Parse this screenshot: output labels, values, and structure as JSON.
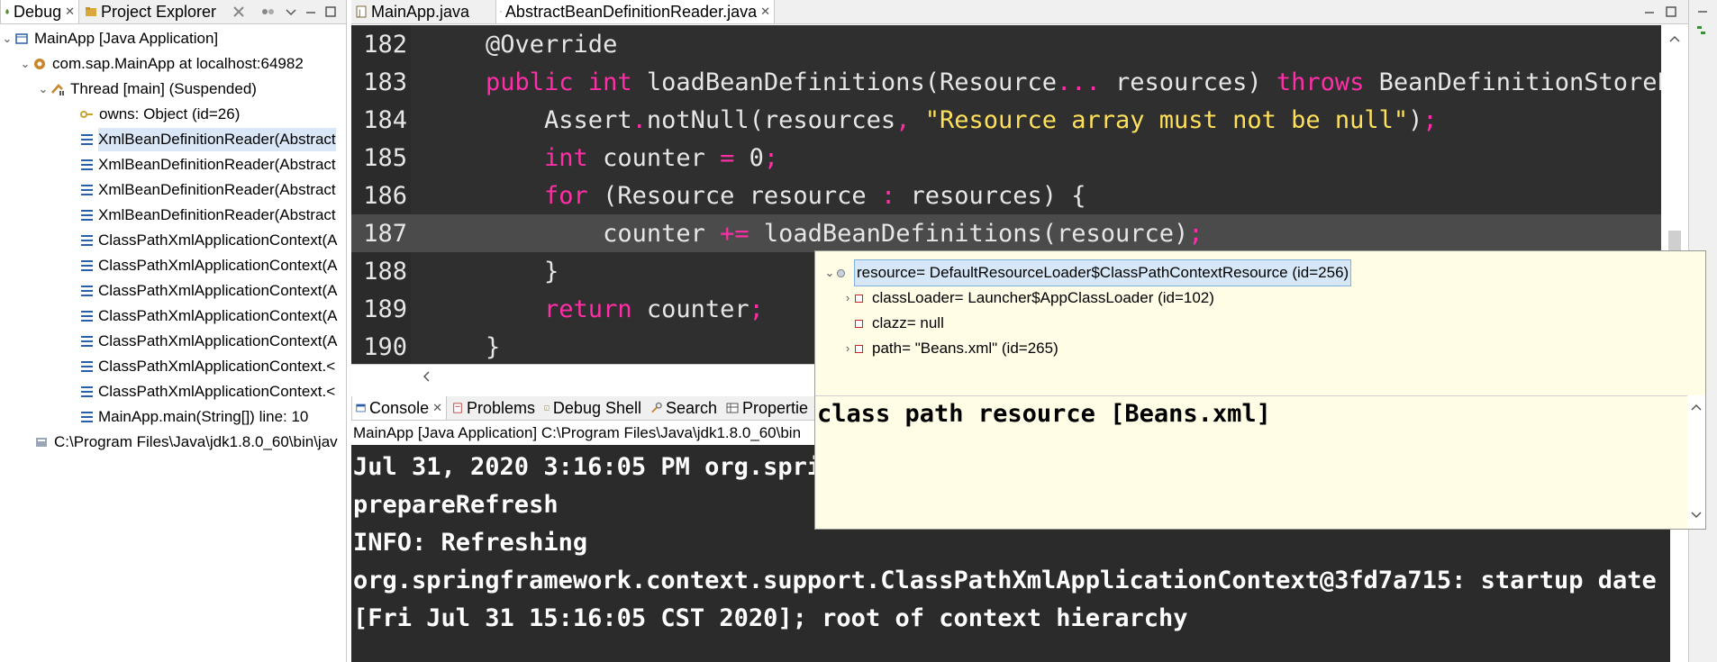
{
  "left_panel": {
    "tabs": [
      {
        "label": "Debug",
        "close": "✕"
      },
      {
        "label": "Project Explorer",
        "close": "✕"
      }
    ],
    "tree": [
      {
        "label": "MainApp [Java Application]"
      },
      {
        "label": "com.sap.MainApp at localhost:64982"
      },
      {
        "label": "Thread [main] (Suspended)"
      },
      {
        "label": "owns: Object  (id=26)"
      },
      {
        "label": "XmlBeanDefinitionReader(Abstract"
      },
      {
        "label": "XmlBeanDefinitionReader(Abstract"
      },
      {
        "label": "XmlBeanDefinitionReader(Abstract"
      },
      {
        "label": "XmlBeanDefinitionReader(Abstract"
      },
      {
        "label": "ClassPathXmlApplicationContext(A"
      },
      {
        "label": "ClassPathXmlApplicationContext(A"
      },
      {
        "label": "ClassPathXmlApplicationContext(A"
      },
      {
        "label": "ClassPathXmlApplicationContext(A"
      },
      {
        "label": "ClassPathXmlApplicationContext(A"
      },
      {
        "label": "ClassPathXmlApplicationContext.<"
      },
      {
        "label": "ClassPathXmlApplicationContext.<"
      },
      {
        "label": "MainApp.main(String[]) line: 10"
      },
      {
        "label": "C:\\Program Files\\Java\\jdk1.8.0_60\\bin\\jav"
      }
    ]
  },
  "editor": {
    "tabs": [
      {
        "label": "MainApp.java"
      },
      {
        "label": "AbstractBeanDefinitionReader.java",
        "close": "✕"
      }
    ],
    "lines": [
      {
        "num": "182",
        "parts": [
          [
            "ident",
            "    @Override"
          ]
        ]
      },
      {
        "num": "183",
        "parts": [
          [
            "kw",
            "    public int "
          ],
          [
            "ident",
            "loadBeanDefinitions(Resource"
          ],
          [
            "op",
            "..."
          ],
          [
            "ident",
            " resources) "
          ],
          [
            "kw",
            "throws "
          ],
          [
            "ident",
            "BeanDefinitionStoreEx"
          ]
        ]
      },
      {
        "num": "184",
        "parts": [
          [
            "ident",
            "        Assert"
          ],
          [
            "op",
            "."
          ],
          [
            "ident",
            "notNull(resources"
          ],
          [
            "op",
            ", "
          ],
          [
            "str",
            "\"Resource array must not be null\""
          ],
          [
            "ident",
            ")"
          ],
          [
            "op",
            ";"
          ]
        ]
      },
      {
        "num": "185",
        "parts": [
          [
            "kw",
            "        int "
          ],
          [
            "ident",
            "counter "
          ],
          [
            "op",
            "= "
          ],
          [
            "ident",
            "0"
          ],
          [
            "op",
            ";"
          ]
        ]
      },
      {
        "num": "186",
        "parts": [
          [
            "kw",
            "        for "
          ],
          [
            "ident",
            "(Resource resource "
          ],
          [
            "op",
            ": "
          ],
          [
            "ident",
            "resources) {"
          ]
        ]
      },
      {
        "num": "187",
        "parts": [
          [
            "ident",
            "            counter "
          ],
          [
            "op",
            "+= "
          ],
          [
            "ident",
            "loadBeanDefinitions(resource)"
          ],
          [
            "op",
            ";"
          ]
        ]
      },
      {
        "num": "188",
        "parts": [
          [
            "ident",
            "        }"
          ]
        ]
      },
      {
        "num": "189",
        "parts": [
          [
            "kw",
            "        return "
          ],
          [
            "ident",
            "counter"
          ],
          [
            "op",
            ";"
          ]
        ]
      },
      {
        "num": "190",
        "parts": [
          [
            "ident",
            "    }"
          ]
        ]
      }
    ]
  },
  "console": {
    "tabs": [
      {
        "label": "Console",
        "close": "✕"
      },
      {
        "label": "Problems"
      },
      {
        "label": "Debug Shell"
      },
      {
        "label": "Search"
      },
      {
        "label": "Propertie"
      }
    ],
    "subtitle": "MainApp [Java Application] C:\\Program Files\\Java\\jdk1.8.0_60\\bin",
    "lines": [
      "Jul 31, 2020 3:16:05 PM org.spri",
      "prepareRefresh",
      "INFO: Refreshing",
      "org.springframework.context.support.ClassPathXmlApplicationContext@3fd7a715: startup date",
      "[Fri Jul 31 15:16:05 CST 2020]; root of context hierarchy"
    ]
  },
  "popup": {
    "rows": [
      {
        "label": "resource= DefaultResourceLoader$ClassPathContextResource  (id=256)"
      },
      {
        "label": "classLoader= Launcher$AppClassLoader  (id=102)"
      },
      {
        "label": "clazz= null"
      },
      {
        "label": "path= \"Beans.xml\" (id=265)"
      }
    ],
    "detail": "class path resource [Beans.xml]"
  },
  "colors": {
    "editor_bg": "#2f2f2f",
    "keyword": "#ff2ea6",
    "string": "#ffe05a",
    "popup_bg": "#fffde6",
    "selection": "#d9e7f7"
  }
}
